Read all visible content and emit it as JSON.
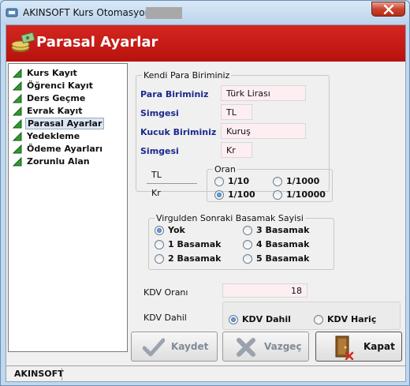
{
  "window": {
    "title": "AKINSOFT Kurs Otomasyonu s"
  },
  "header": {
    "title": "Parasal Ayarlar"
  },
  "sidebar": {
    "items": [
      {
        "label": "Kurs Kayıt",
        "active": false
      },
      {
        "label": "Öğrenci Kayıt",
        "active": false
      },
      {
        "label": "Ders Geçme",
        "active": false
      },
      {
        "label": "Evrak Kayıt",
        "active": false
      },
      {
        "label": "Parasal Ayarlar",
        "active": true
      },
      {
        "label": "Yedekleme",
        "active": false
      },
      {
        "label": "Ödeme Ayarları",
        "active": false
      },
      {
        "label": "Zorunlu Alan",
        "active": false
      }
    ]
  },
  "currency": {
    "group_label": "Kendi Para Biriminiz",
    "unit_label": "Para Biriminiz",
    "unit_value": "Türk Lirası",
    "symbol_label": "Simgesi",
    "symbol_value": "TL",
    "subunit_label": "Kucuk Biriminiz",
    "subunit_value": "Kuruş",
    "subsymbol_label": "Simgesi",
    "subsymbol_value": "Kr",
    "ratio_top": "TL",
    "ratio_bottom": "Kr"
  },
  "oran": {
    "label": "Oran",
    "options": [
      {
        "label": "1/10",
        "selected": false
      },
      {
        "label": "1/1000",
        "selected": false
      },
      {
        "label": "1/100",
        "selected": true
      },
      {
        "label": "1/10000",
        "selected": false
      }
    ]
  },
  "decimals": {
    "label": "Virgulden Sonraki Basamak Sayisi",
    "options": [
      {
        "label": "Yok",
        "selected": true
      },
      {
        "label": "3 Basamak",
        "selected": false
      },
      {
        "label": "1 Basamak",
        "selected": false
      },
      {
        "label": "4 Basamak",
        "selected": false
      },
      {
        "label": "2 Basamak",
        "selected": false
      },
      {
        "label": "5 Basamak",
        "selected": false
      }
    ]
  },
  "kdv": {
    "rate_label": "KDV Oranı",
    "rate_value": "18",
    "included_label": "KDV Dahil",
    "options": [
      {
        "label": "KDV Dahil",
        "selected": true
      },
      {
        "label": "KDV Hariç",
        "selected": false
      }
    ]
  },
  "buttons": {
    "save": "Kaydet",
    "cancel": "Vazgeç",
    "close": "Kapat"
  },
  "status": {
    "text": "AKINSOFT"
  },
  "colors": {
    "header_red": "#c81a16",
    "label_blue": "#1a2a8c",
    "input_pink": "#fdeef2"
  }
}
